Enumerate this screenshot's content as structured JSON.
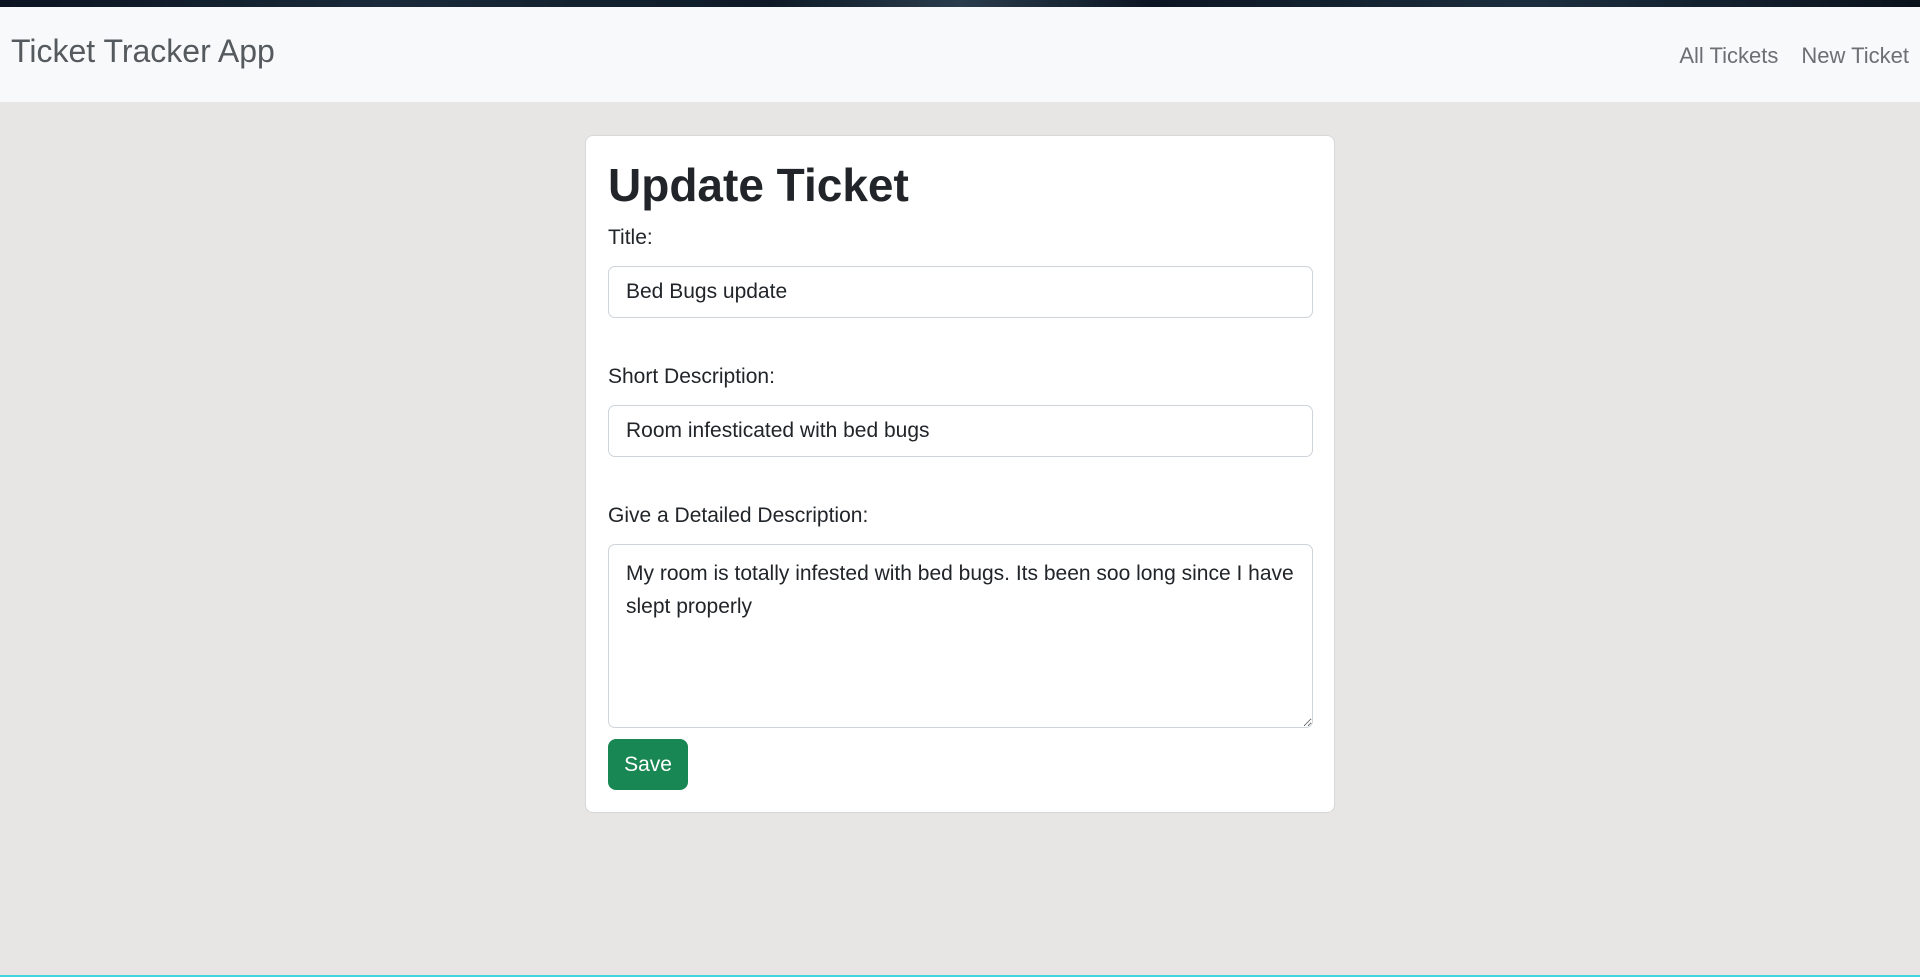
{
  "app": {
    "brand": "Ticket Tracker App"
  },
  "nav": {
    "items": [
      {
        "label": "All Tickets"
      },
      {
        "label": "New Ticket"
      }
    ]
  },
  "form": {
    "heading": "Update Ticket",
    "title_label": "Title:",
    "title_value": "Bed Bugs update",
    "short_label": "Short Description:",
    "short_value": "Room infesticated with bed bugs",
    "detail_label": "Give a Detailed Description:",
    "detail_value": "My room is totally infested with bed bugs. Its been soo long since I have slept properly",
    "save_label": "Save"
  },
  "colors": {
    "save_button": "#198754",
    "navbar_bg": "#f8f9fa",
    "page_bg": "#e8e6e4"
  }
}
